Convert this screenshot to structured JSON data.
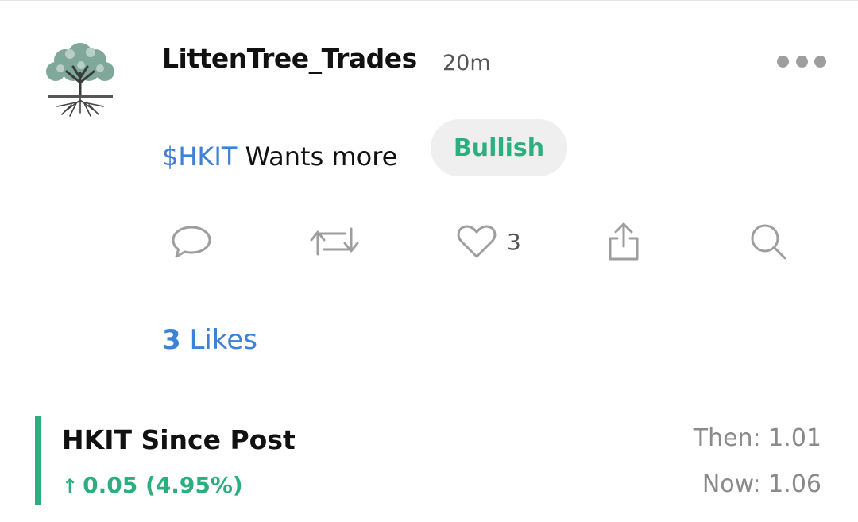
{
  "post": {
    "username": "LittenTree_Trades",
    "timestamp": "20m",
    "cashtag": "$HKIT",
    "message": " Wants more",
    "sentiment": "Bullish"
  },
  "actions": {
    "reply_icon": "speech-bubble-icon",
    "reshare_icon": "repost-icon",
    "like_icon": "heart-icon",
    "like_count": "3",
    "share_icon": "share-upload-icon",
    "search_icon": "magnifier-icon"
  },
  "likes_summary": {
    "count": "3",
    "label": " Likes"
  },
  "performance": {
    "title": "HKIT Since Post",
    "change_arrow": "↑",
    "change": "0.05 (4.95%)",
    "then": "Then: 1.01",
    "now": "Now: 1.06"
  },
  "colors": {
    "link_blue": "#3e82d5",
    "bullish_green": "#2cae7f",
    "muted_gray": "#8a8a8a",
    "icon_gray": "#9e9e9e"
  }
}
